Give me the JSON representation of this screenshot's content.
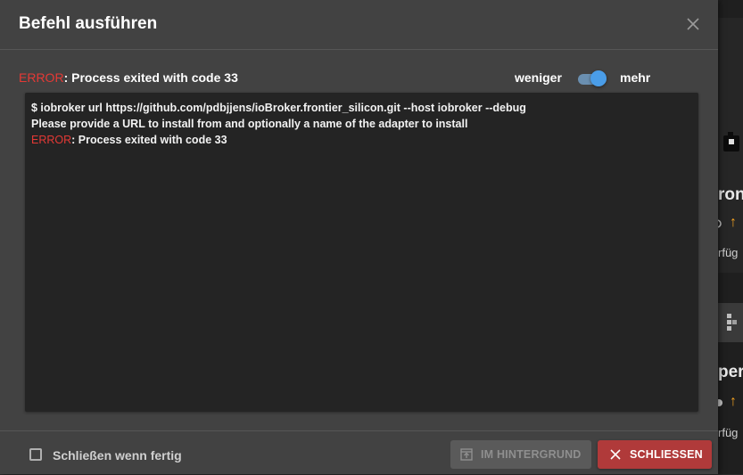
{
  "dialog": {
    "title": "Befehl ausführen",
    "status": {
      "prefix": "ERROR",
      "text": ": Process exited with code 33"
    },
    "toggle": {
      "less_label": "weniger",
      "more_label": "mehr",
      "checked": true
    },
    "console": {
      "lines": [
        {
          "prefix": "",
          "text": "$ iobroker url https://github.com/pdbjjens/ioBroker.frontier_silicon.git --host iobroker --debug"
        },
        {
          "prefix": "",
          "text": "Please provide a URL to install from and optionally a name of the adapter to install"
        },
        {
          "prefix": "ERROR",
          "text": ": Process exited with code 33"
        }
      ]
    },
    "footer": {
      "checkbox_label": "Schließen wenn fertig",
      "checkbox_checked": false,
      "background_button": "IM HINTERGRUND",
      "close_button": "SCHLIESSEN"
    }
  },
  "background_app": {
    "text_1": "ron",
    "text_2": "rfüg",
    "text_3": "per",
    "text_4": "rfüg"
  },
  "colors": {
    "error": "#e53935",
    "accent": "#4a9de8",
    "close_button": "#b03a3a",
    "update_arrow": "#f0a020"
  },
  "icons": {
    "close": "close-icon",
    "background": "open-in-background-icon",
    "close_button": "close-icon"
  }
}
